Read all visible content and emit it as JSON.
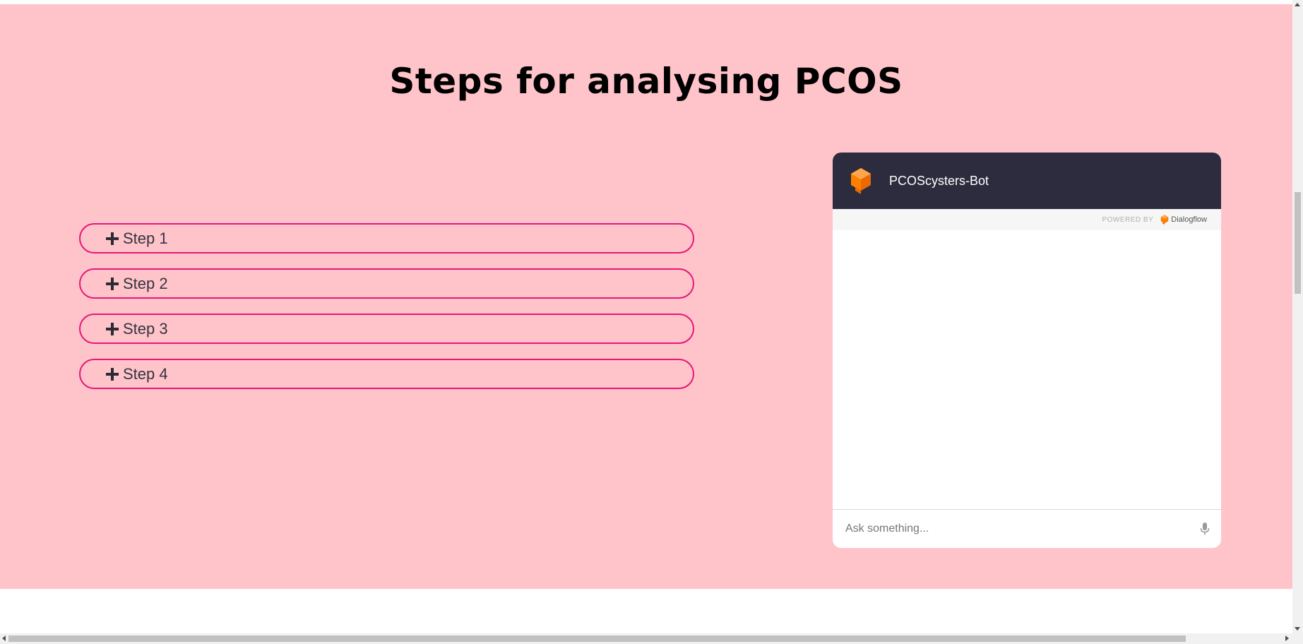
{
  "section": {
    "title": "Steps for analysing PCOS",
    "background_color": "#ffc4ca",
    "accent_color": "#e8167a"
  },
  "steps": [
    {
      "label": "Step 1",
      "icon": "plus-icon"
    },
    {
      "label": "Step 2",
      "icon": "plus-icon"
    },
    {
      "label": "Step 3",
      "icon": "plus-icon"
    },
    {
      "label": "Step 4",
      "icon": "plus-icon"
    }
  ],
  "chatbot": {
    "title": "PCOScysters-Bot",
    "logo_icon": "dialogflow-logo-icon",
    "powered_by_label": "POWERED BY",
    "powered_by_brand": "Dialogflow",
    "input_placeholder": "Ask something...",
    "mic_icon": "microphone-icon",
    "header_color": "#2c2c3e",
    "logo_color": "#ff7f00"
  }
}
